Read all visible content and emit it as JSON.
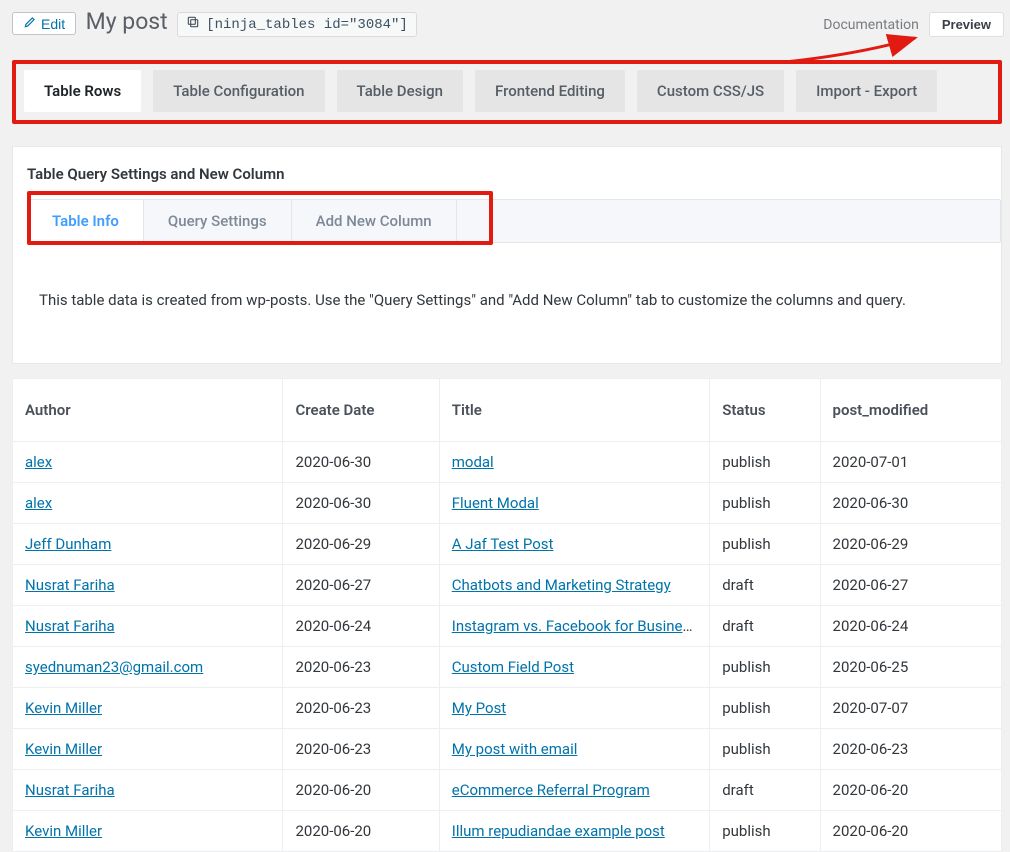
{
  "header": {
    "edit_label": "Edit",
    "title": "My post",
    "shortcode": "[ninja_tables id=\"3084\"]",
    "doc_label": "Documentation",
    "preview_label": "Preview"
  },
  "main_tabs": [
    "Table Rows",
    "Table Configuration",
    "Table Design",
    "Frontend Editing",
    "Custom CSS/JS",
    "Import - Export"
  ],
  "main_tabs_active_index": 0,
  "settings": {
    "card_title": "Table Query Settings and New Column",
    "sub_tabs": [
      "Table Info",
      "Query Settings",
      "Add New Column"
    ],
    "sub_tabs_active_index": 0,
    "panel_text": "This table data is created from wp-posts. Use the \"Query Settings\" and \"Add New Column\" tab to customize the columns and query."
  },
  "table": {
    "columns": [
      "Author",
      "Create Date",
      "Title",
      "Status",
      "post_modified"
    ],
    "rows": [
      {
        "author": "alex",
        "create_date": "2020-06-30",
        "title": "modal",
        "status": "publish",
        "post_modified": "2020-07-01"
      },
      {
        "author": "alex",
        "create_date": "2020-06-30",
        "title": "Fluent Modal",
        "status": "publish",
        "post_modified": "2020-06-30"
      },
      {
        "author": "Jeff Dunham",
        "create_date": "2020-06-29",
        "title": "A Jaf Test Post",
        "status": "publish",
        "post_modified": "2020-06-29"
      },
      {
        "author": "Nusrat Fariha",
        "create_date": "2020-06-27",
        "title": "Chatbots and Marketing Strategy",
        "status": "draft",
        "post_modified": "2020-06-27"
      },
      {
        "author": "Nusrat Fariha",
        "create_date": "2020-06-24",
        "title": "Instagram vs. Facebook for Business",
        "status": "draft",
        "post_modified": "2020-06-24"
      },
      {
        "author": "syednuman23@gmail.com",
        "create_date": "2020-06-23",
        "title": "Custom Field Post",
        "status": "publish",
        "post_modified": "2020-06-25"
      },
      {
        "author": "Kevin Miller",
        "create_date": "2020-06-23",
        "title": "My Post",
        "status": "publish",
        "post_modified": "2020-07-07"
      },
      {
        "author": "Kevin Miller",
        "create_date": "2020-06-23",
        "title": "My post with email",
        "status": "publish",
        "post_modified": "2020-06-23"
      },
      {
        "author": "Nusrat Fariha",
        "create_date": "2020-06-20",
        "title": "eCommerce Referral Program",
        "status": "draft",
        "post_modified": "2020-06-20"
      },
      {
        "author": "Kevin Miller",
        "create_date": "2020-06-20",
        "title": "Illum repudiandae example post",
        "status": "publish",
        "post_modified": "2020-06-20"
      }
    ]
  },
  "annotation": {
    "arrow_color": "#e11b11",
    "highlight_color": "#e11b11"
  }
}
